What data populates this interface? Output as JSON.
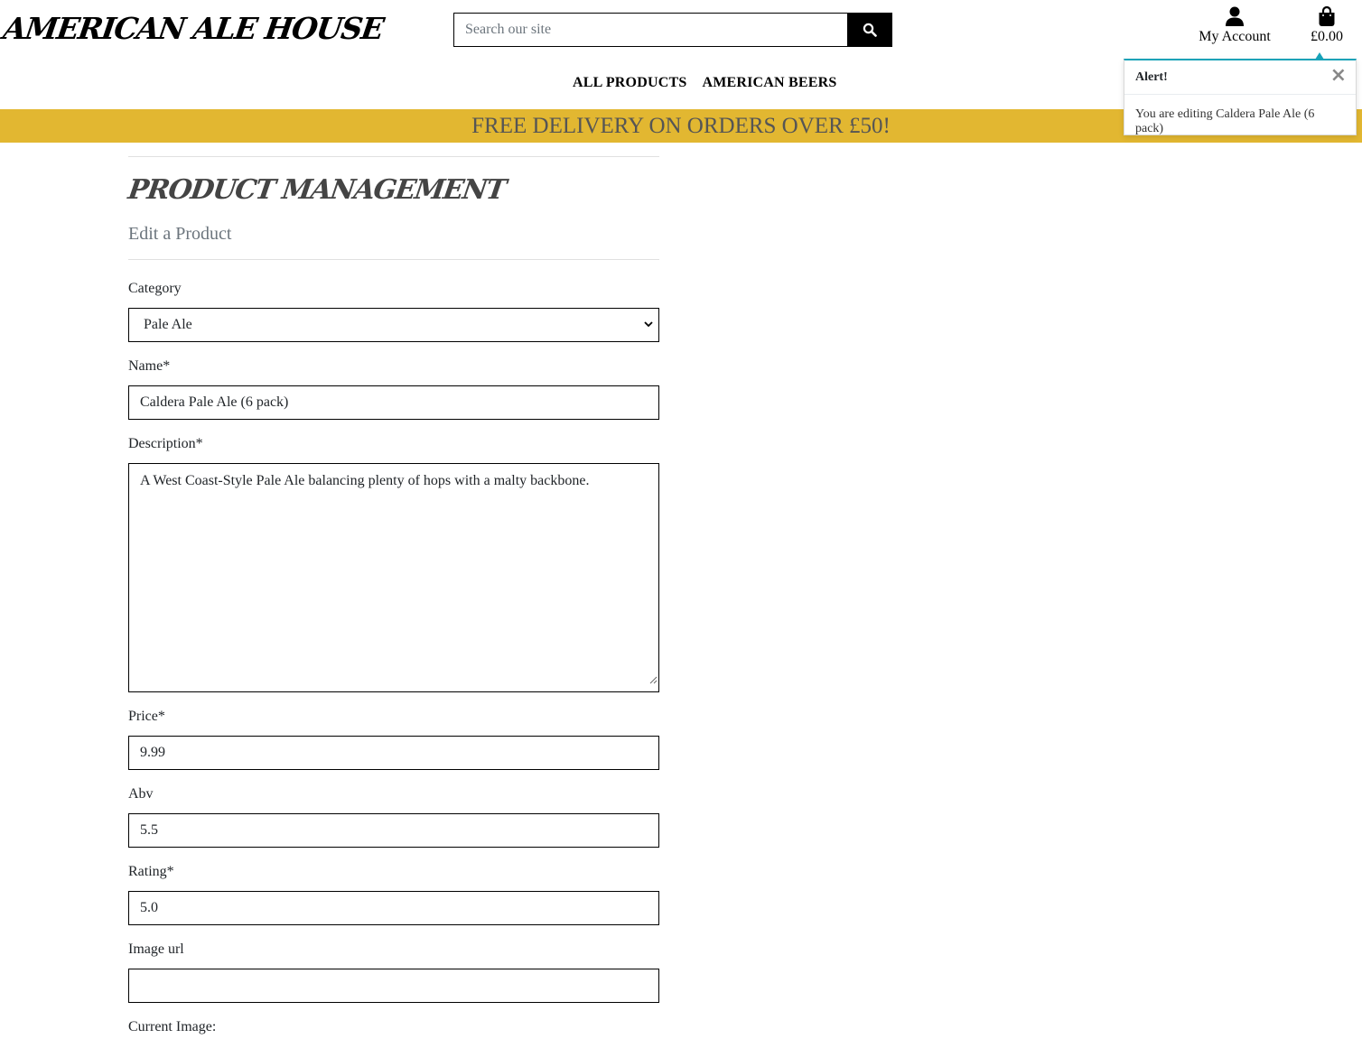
{
  "header": {
    "logo": "AMERICAN ALE HOUSE",
    "search_placeholder": "Search our site",
    "account_label": "My Account",
    "bag_total": "£0.00"
  },
  "nav": {
    "items": [
      {
        "label": "ALL PRODUCTS"
      },
      {
        "label": "AMERICAN BEERS"
      }
    ]
  },
  "banner": {
    "text": "FREE DELIVERY ON ORDERS OVER £50!",
    "color": "#e2b731"
  },
  "toast": {
    "title": "Alert!",
    "message": "You are editing Caldera Pale Ale (6 pack)",
    "accent": "#17a2b8"
  },
  "page": {
    "title": "PRODUCT MANAGEMENT",
    "subtitle": "Edit a Product"
  },
  "form": {
    "category": {
      "label": "Category",
      "value": "Pale Ale"
    },
    "name": {
      "label": "Name*",
      "value": "Caldera Pale Ale (6 pack)"
    },
    "description": {
      "label": "Description*",
      "value": "A West Coast-Style Pale Ale balancing plenty of hops with a malty backbone."
    },
    "price": {
      "label": "Price*",
      "value": "9.99"
    },
    "abv": {
      "label": "Abv",
      "value": "5.5"
    },
    "rating": {
      "label": "Rating*",
      "value": "5.0"
    },
    "image_url": {
      "label": "Image url",
      "value": ""
    },
    "current_image": {
      "label": "Current Image:"
    }
  }
}
